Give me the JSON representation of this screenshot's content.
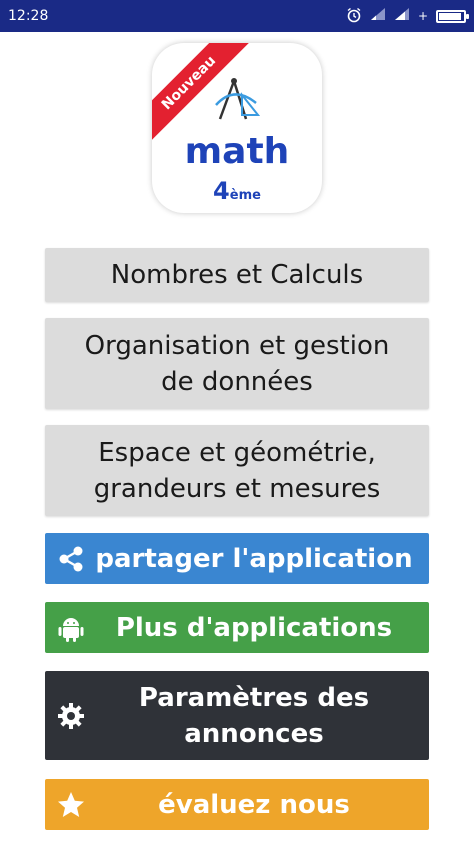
{
  "status_bar": {
    "time": "12:28",
    "icons": [
      "alarm-icon",
      "signal-icon",
      "signal-icon",
      "charging-icon",
      "battery-icon"
    ]
  },
  "logo": {
    "ribbon": "Nouveau",
    "title": "math",
    "level": "4",
    "level_suffix": "ème",
    "icon": "compass-icon"
  },
  "menu": {
    "nombres": "Nombres et Calculs",
    "organisation": "Organisation et gestion\nde données",
    "espace": "Espace et géométrie,\ngrandeurs et mesures"
  },
  "actions": {
    "share": {
      "label": "partager l'application",
      "icon": "share-icon",
      "color": "#3a86d1"
    },
    "more_apps": {
      "label": "Plus d'applications",
      "icon": "android-icon",
      "color": "#45a048"
    },
    "ads_settings": {
      "label": "Paramètres des\nannonces",
      "icon": "gear-icon",
      "color": "#2f3238"
    },
    "rate": {
      "label": "évaluez nous",
      "icon": "star-icon",
      "color": "#eea52a"
    }
  },
  "colors": {
    "status_bar": "#1a2a86",
    "button_gray": "#dcdcdc",
    "brand_blue": "#1e43b8",
    "ribbon_red": "#e32130"
  }
}
